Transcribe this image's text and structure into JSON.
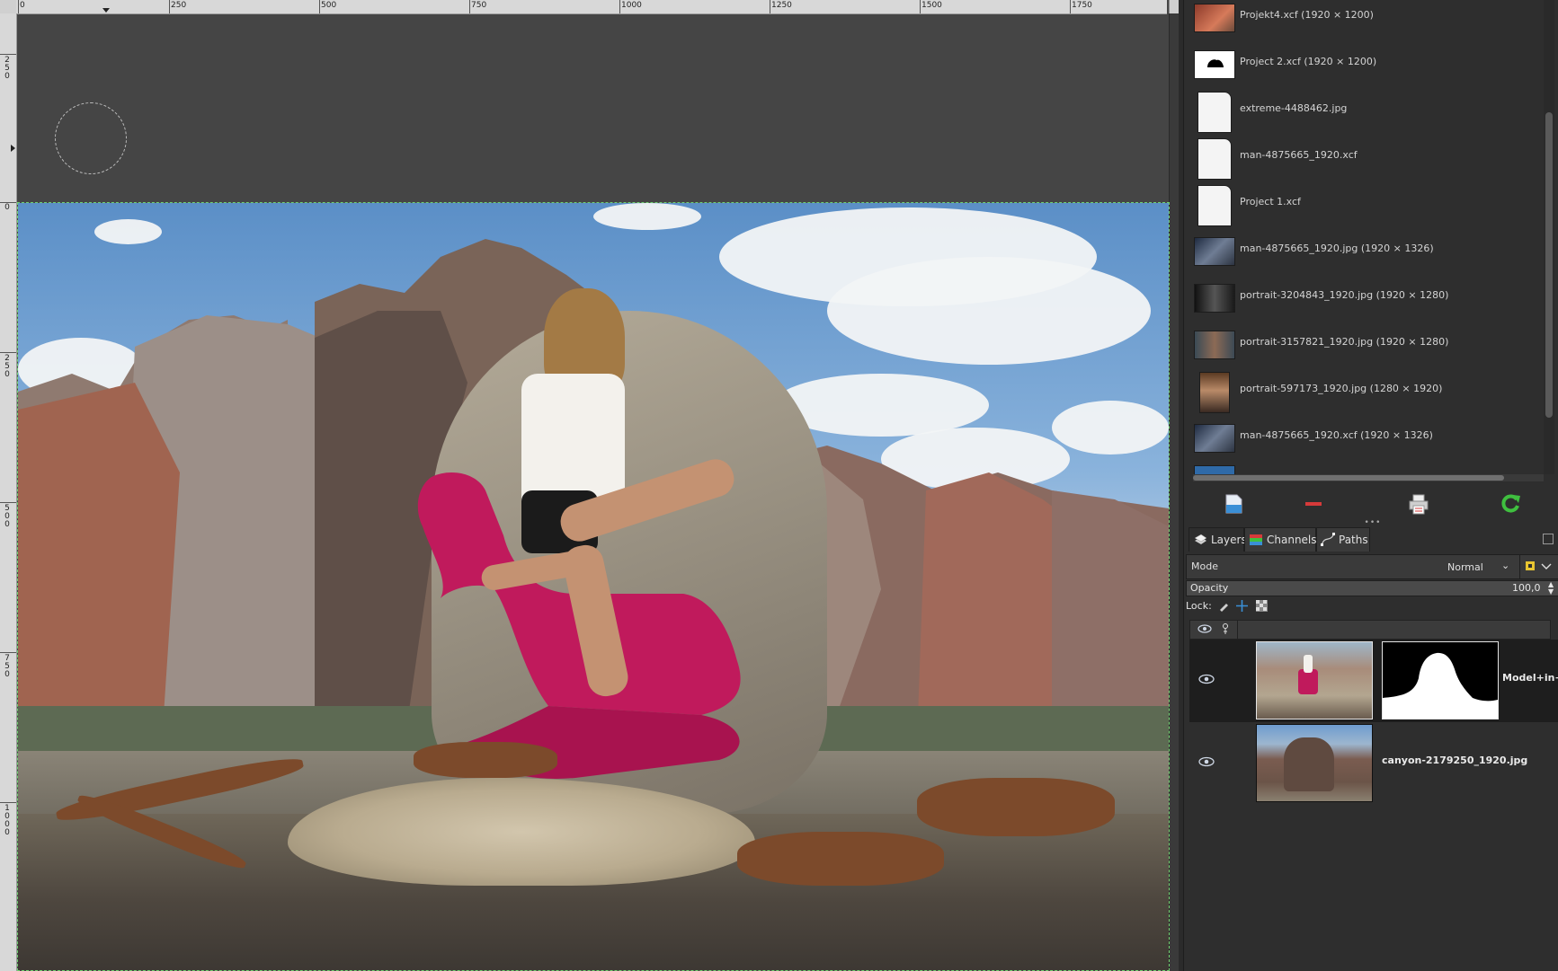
{
  "rulers": {
    "horizontal_labels": [
      "0",
      "250",
      "500",
      "750",
      "1000",
      "1250",
      "1500",
      "1750"
    ],
    "vertical_labels": [
      "250",
      "0",
      "250",
      "500",
      "750",
      "1000"
    ]
  },
  "image_list": [
    {
      "label": "Projekt4.xcf (1920 × 1200)",
      "thumb": "photo"
    },
    {
      "label": "Project 2.xcf (1920 × 1200)",
      "thumb": "mask"
    },
    {
      "label": "extreme-4488462.jpg",
      "thumb": "document"
    },
    {
      "label": "man-4875665_1920.xcf",
      "thumb": "document"
    },
    {
      "label": "Project 1.xcf",
      "thumb": "document"
    },
    {
      "label": "man-4875665_1920.jpg (1920 × 1326)",
      "thumb": "photo"
    },
    {
      "label": "portrait-3204843_1920.jpg (1920 × 1280)",
      "thumb": "photo"
    },
    {
      "label": "portrait-3157821_1920.jpg (1920 × 1280)",
      "thumb": "photo"
    },
    {
      "label": "portrait-597173_1920.jpg (1280 × 1920)",
      "thumb": "photo"
    },
    {
      "label": "man-4875665_1920.xcf (1920 × 1326)",
      "thumb": "photo"
    }
  ],
  "images_toolbar": {
    "icons": [
      "new-display-icon",
      "delete-icon",
      "print-icon",
      "refresh-icon"
    ]
  },
  "tabs": {
    "layers": "Layers",
    "channels": "Channels",
    "paths": "Paths"
  },
  "layer_controls": {
    "mode_label": "Mode",
    "mode_value": "Normal",
    "opacity_label": "Opacity",
    "opacity_value": "100,0",
    "lock_label": "Lock:"
  },
  "layers": [
    {
      "name": "Model+in+",
      "visible": true,
      "has_mask": true
    },
    {
      "name": "canyon-2179250_1920.jpg",
      "visible": true,
      "has_mask": false
    }
  ],
  "colors": {
    "panel_bg": "#2e2e2e",
    "canvas_bg": "#454545",
    "selection_outline": "#6fd06f",
    "accent_red": "#d63a3a",
    "accent_green": "#3fbf3f",
    "accent_blue": "#3a8fd6"
  }
}
